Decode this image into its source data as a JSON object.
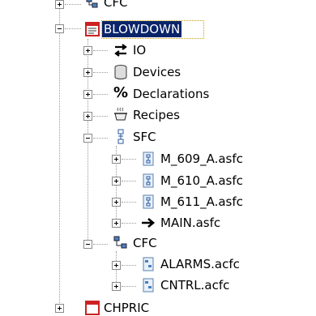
{
  "tree": {
    "top_partial_label": "CFC",
    "blowdown": {
      "label": "BLOWDOWN",
      "children": {
        "io": "IO",
        "devices": "Devices",
        "declarations": "Declarations",
        "recipes": "Recipes",
        "sfc": {
          "label": "SFC",
          "files": [
            "M_609_A.asfc",
            "M_610_A.asfc",
            "M_611_A.asfc",
            "MAIN.asfc"
          ]
        },
        "cfc": {
          "label": "CFC",
          "files": [
            "ALARMS.acfc",
            "CNTRL.acfc"
          ]
        }
      }
    },
    "bottom_partial_label": "CHPRIC"
  },
  "colors": {
    "selection_bg": "#0a246a",
    "selection_text": "#ffffff",
    "tree_lines": "#9a9a9a",
    "program_icon_red": "#cc2222"
  }
}
